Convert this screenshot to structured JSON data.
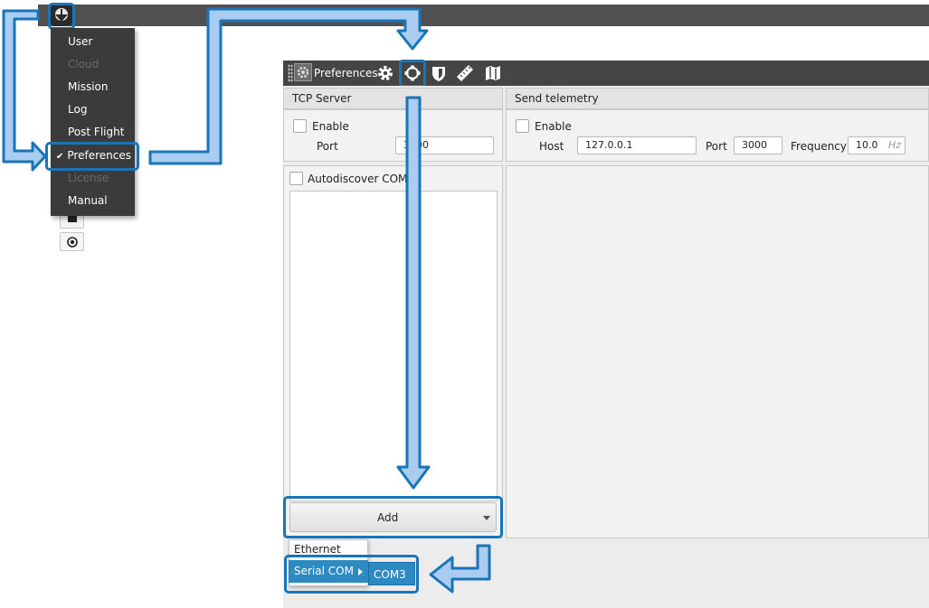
{
  "colors": {
    "accent": "#1a74b8",
    "arrow_fill": "#a9cdf0",
    "topbar": "#505050",
    "menu_bg": "#3b3b3b",
    "toolbar": "#454545",
    "highlight": "#2d8ac2"
  },
  "main_menu": {
    "items": [
      {
        "label": "User",
        "enabled": true
      },
      {
        "label": "Cloud",
        "enabled": false
      },
      {
        "label": "Mission",
        "enabled": true
      },
      {
        "label": "Log",
        "enabled": true
      },
      {
        "label": "Post Flight",
        "enabled": true
      },
      {
        "label": "Preferences",
        "enabled": true,
        "checked": true
      },
      {
        "label": "License",
        "enabled": false
      },
      {
        "label": "Manual",
        "enabled": true
      }
    ],
    "check_mark": "✔"
  },
  "side_buttons": [
    {
      "icon": "stop-icon"
    },
    {
      "icon": "radio-target-icon"
    }
  ],
  "preferences": {
    "title": "Preferences",
    "tabs": [
      {
        "icon": "gear-icon"
      },
      {
        "icon": "connection-icon"
      },
      {
        "icon": "shield-icon"
      },
      {
        "icon": "ruler-icon"
      },
      {
        "icon": "map-icon"
      }
    ],
    "tcp_server": {
      "header": "TCP Server",
      "enable_label": "Enable",
      "port_label": "Port",
      "port_value": "3000"
    },
    "send_telemetry": {
      "header": "Send telemetry",
      "enable_label": "Enable",
      "host_label": "Host",
      "host_value": "127.0.0.1",
      "port_label": "Port",
      "port_value": "3000",
      "frequency_label": "Frequency",
      "frequency_value": "10.0",
      "frequency_unit": "Hz"
    },
    "autodiscover_label": "Autodiscover COMs",
    "add_button_label": "Add",
    "add_menu": {
      "items": [
        "Ethernet",
        "Serial COM"
      ],
      "submenu": [
        "COM3"
      ]
    }
  }
}
